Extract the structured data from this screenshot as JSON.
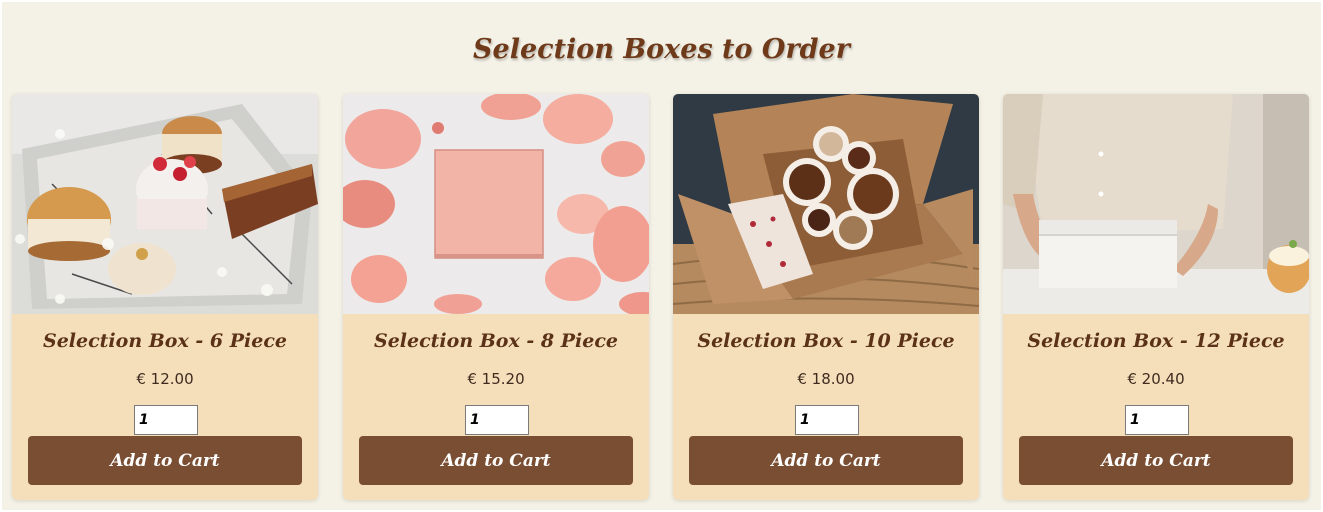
{
  "heading": "Selection Boxes to Order",
  "products": [
    {
      "title": "Selection Box - 6 Piece",
      "price": "€ 12.00",
      "qty": "1",
      "button": "Add to Cart",
      "photo": "pastry-box-photo"
    },
    {
      "title": "Selection Box - 8 Piece",
      "price": "€ 15.20",
      "qty": "1",
      "button": "Add to Cart",
      "photo": "pink-box-rose-petals-photo"
    },
    {
      "title": "Selection Box - 10 Piece",
      "price": "€ 18.00",
      "qty": "1",
      "button": "Add to Cart",
      "photo": "kraft-box-truffles-photo"
    },
    {
      "title": "Selection Box - 12 Piece",
      "price": "€ 20.40",
      "qty": "1",
      "button": "Add to Cart",
      "photo": "white-box-hands-photo"
    }
  ],
  "colors": {
    "page_background": "#f4f1e6",
    "card_background": "#f5dfba",
    "heading_color": "#6e3a1a",
    "button_background": "#7a4e33",
    "button_text": "#ffffff"
  }
}
